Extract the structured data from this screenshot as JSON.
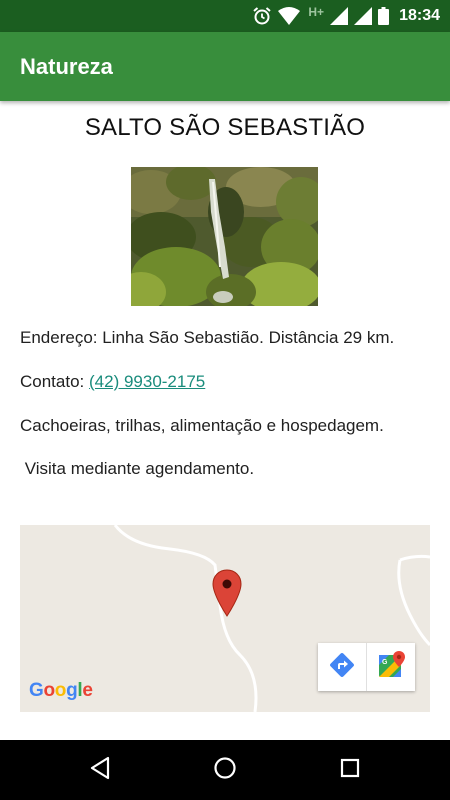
{
  "status_bar": {
    "time": "18:34",
    "network_label": "H+",
    "icons": [
      "alarm-icon",
      "wifi-icon",
      "signal-icon",
      "signal-icon",
      "battery-icon"
    ]
  },
  "app_bar": {
    "title": "Natureza"
  },
  "place": {
    "title": "SALTO SÃO SEBASTIÃO",
    "photo_subject": "waterfall in forested hillside",
    "address_line": "Endereço: Linha São Sebastião. Distância 29 km.",
    "contact_label": "Contato: ",
    "contact_phone": "(42) 9930-2175",
    "services_line": "Cachoeiras, trilhas, alimentação e hospedagem.",
    "visit_line": " Visita mediante agendamento."
  },
  "map": {
    "provider_logo": "Google",
    "marker_icon": "map-pin-icon",
    "toolbar": [
      "directions-icon",
      "google-maps-icon"
    ]
  },
  "nav_bar": {
    "buttons": [
      "back-icon",
      "home-icon",
      "recents-icon"
    ]
  },
  "colors": {
    "status_bar": "#1b5e20",
    "app_bar": "#388e3c",
    "link": "#1a8c7c",
    "map_background": "#ede9e2",
    "pin": "#db4437"
  }
}
